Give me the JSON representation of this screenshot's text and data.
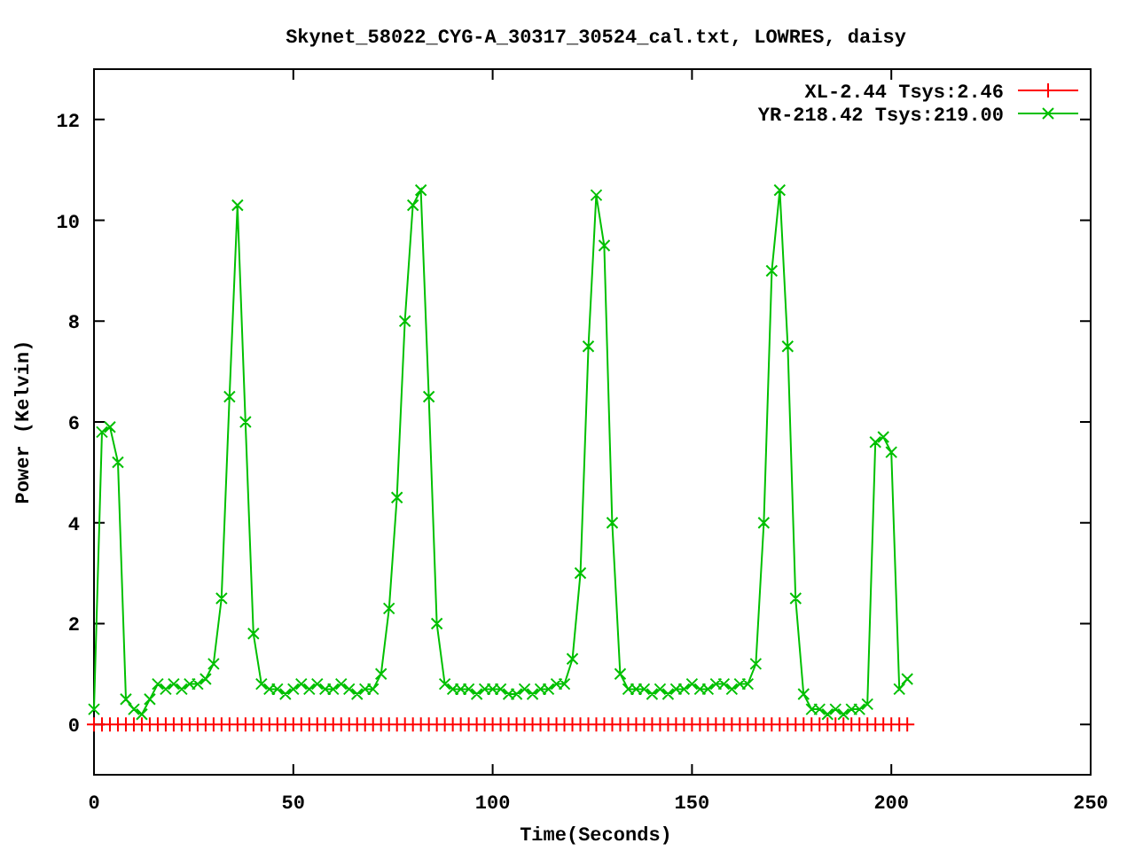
{
  "chart_data": {
    "type": "line",
    "title": "Skynet_58022_CYG-A_30317_30524_cal.txt, LOWRES, daisy",
    "xlabel": "Time(Seconds)",
    "ylabel": "Power (Kelvin)",
    "x": [
      0,
      2,
      4,
      6,
      8,
      10,
      12,
      14,
      16,
      18,
      20,
      22,
      24,
      26,
      28,
      30,
      32,
      34,
      36,
      38,
      40,
      42,
      44,
      46,
      48,
      50,
      52,
      54,
      56,
      58,
      60,
      62,
      64,
      66,
      68,
      70,
      72,
      74,
      76,
      78,
      80,
      82,
      84,
      86,
      88,
      90,
      92,
      94,
      96,
      98,
      100,
      102,
      104,
      106,
      108,
      110,
      112,
      114,
      116,
      118,
      120,
      122,
      124,
      126,
      128,
      130,
      132,
      134,
      136,
      138,
      140,
      142,
      144,
      146,
      148,
      150,
      152,
      154,
      156,
      158,
      160,
      162,
      164,
      166,
      168,
      170,
      172,
      174,
      176,
      178,
      180,
      182,
      184,
      186,
      188,
      190,
      192,
      194,
      196,
      198,
      200,
      202,
      204
    ],
    "series": [
      {
        "name": "XL-2.44 Tsys:2.46",
        "color": "#ff0000",
        "marker": "plus",
        "values": [
          0,
          0,
          0,
          0,
          0,
          0,
          0,
          0,
          0,
          0,
          0,
          0,
          0,
          0,
          0,
          0,
          0,
          0,
          0,
          0,
          0,
          0,
          0,
          0,
          0,
          0,
          0,
          0,
          0,
          0,
          0,
          0,
          0,
          0,
          0,
          0,
          0,
          0,
          0,
          0,
          0,
          0,
          0,
          0,
          0,
          0,
          0,
          0,
          0,
          0,
          0,
          0,
          0,
          0,
          0,
          0,
          0,
          0,
          0,
          0,
          0,
          0,
          0,
          0,
          0,
          0,
          0,
          0,
          0,
          0,
          0,
          0,
          0,
          0,
          0,
          0,
          0,
          0,
          0,
          0,
          0,
          0,
          0,
          0,
          0,
          0,
          0,
          0,
          0,
          0,
          0,
          0,
          0,
          0,
          0,
          0,
          0,
          0,
          0,
          0,
          0,
          0,
          0
        ]
      },
      {
        "name": "YR-218.42 Tsys:219.00",
        "color": "#00c000",
        "marker": "cross",
        "values": [
          0.3,
          5.8,
          5.9,
          5.2,
          0.5,
          0.3,
          0.2,
          0.5,
          0.8,
          0.7,
          0.8,
          0.7,
          0.8,
          0.8,
          0.9,
          1.2,
          2.5,
          6.5,
          10.3,
          6.0,
          1.8,
          0.8,
          0.7,
          0.7,
          0.6,
          0.7,
          0.8,
          0.7,
          0.8,
          0.7,
          0.7,
          0.8,
          0.7,
          0.6,
          0.7,
          0.7,
          1.0,
          2.3,
          4.5,
          8.0,
          10.3,
          10.6,
          6.5,
          2.0,
          0.8,
          0.7,
          0.7,
          0.7,
          0.6,
          0.7,
          0.7,
          0.7,
          0.6,
          0.6,
          0.7,
          0.6,
          0.7,
          0.7,
          0.8,
          0.8,
          1.3,
          3.0,
          7.5,
          10.5,
          9.5,
          4.0,
          1.0,
          0.7,
          0.7,
          0.7,
          0.6,
          0.7,
          0.6,
          0.7,
          0.7,
          0.8,
          0.7,
          0.7,
          0.8,
          0.8,
          0.7,
          0.8,
          0.8,
          1.2,
          4.0,
          9.0,
          10.6,
          7.5,
          2.5,
          0.6,
          0.3,
          0.3,
          0.2,
          0.3,
          0.2,
          0.3,
          0.3,
          0.4,
          5.6,
          5.7,
          5.4,
          0.7,
          0.9
        ]
      }
    ],
    "legend": "upper right",
    "xlim": [
      0,
      250
    ],
    "ylim": [
      -1,
      13
    ],
    "xticks": [
      0,
      50,
      100,
      150,
      200,
      250
    ],
    "yticks": [
      0,
      2,
      4,
      6,
      8,
      10,
      12
    ]
  }
}
